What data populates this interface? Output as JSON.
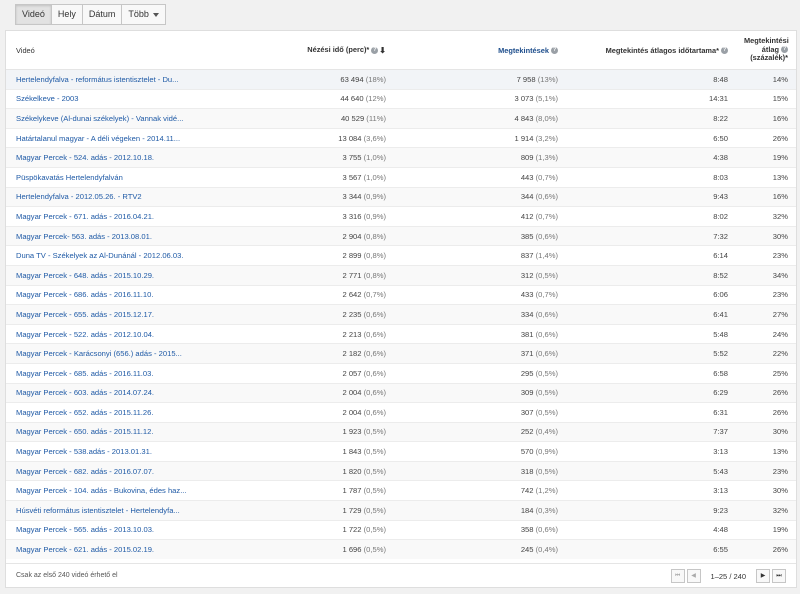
{
  "tabs": [
    {
      "label": "Videó",
      "active": true
    },
    {
      "label": "Hely",
      "active": false
    },
    {
      "label": "Dátum",
      "active": false
    },
    {
      "label": "Több",
      "active": false,
      "dropdown": true
    }
  ],
  "table": {
    "headers": {
      "video": "Videó",
      "watch_time": "Nézési idő (perc)*",
      "views": "Megtekintések",
      "avg_duration": "Megtekintés átlagos időtartama*",
      "avg_pct_line1": "Megtekintési",
      "avg_pct_line2": "átlag",
      "avg_pct_line3": "(százalék)*"
    },
    "help_glyph": "?",
    "sort_glyph": "⬇",
    "rows": [
      {
        "title": "Hertelendyfalva - református istentisztelet - Du...",
        "watch": "63 494",
        "watch_pct": "(18%)",
        "views": "7 958",
        "views_pct": "(13%)",
        "dur": "8:48",
        "avg": "14%"
      },
      {
        "title": "Székelkeve - 2003",
        "watch": "44 640",
        "watch_pct": "(12%)",
        "views": "3 073",
        "views_pct": "(5,1%)",
        "dur": "14:31",
        "avg": "15%"
      },
      {
        "title": "Székelykeve (Al-dunai székelyek) - Vannak vidé...",
        "watch": "40 529",
        "watch_pct": "(11%)",
        "views": "4 843",
        "views_pct": "(8,0%)",
        "dur": "8:22",
        "avg": "16%"
      },
      {
        "title": "Határtalanul magyar - A déli végeken - 2014.11...",
        "watch": "13 084",
        "watch_pct": "(3,6%)",
        "views": "1 914",
        "views_pct": "(3,2%)",
        "dur": "6:50",
        "avg": "26%"
      },
      {
        "title": "Magyar Percek - 524. adás - 2012.10.18.",
        "watch": "3 755",
        "watch_pct": "(1,0%)",
        "views": "809",
        "views_pct": "(1,3%)",
        "dur": "4:38",
        "avg": "19%"
      },
      {
        "title": "Püspökavatás Hertelendyfalván",
        "watch": "3 567",
        "watch_pct": "(1,0%)",
        "views": "443",
        "views_pct": "(0,7%)",
        "dur": "8:03",
        "avg": "13%"
      },
      {
        "title": "Hertelendyfalva - 2012.05.26. - RTV2",
        "watch": "3 344",
        "watch_pct": "(0,9%)",
        "views": "344",
        "views_pct": "(0,6%)",
        "dur": "9:43",
        "avg": "16%"
      },
      {
        "title": "Magyar Percek - 671. adás - 2016.04.21.",
        "watch": "3 316",
        "watch_pct": "(0,9%)",
        "views": "412",
        "views_pct": "(0,7%)",
        "dur": "8:02",
        "avg": "32%"
      },
      {
        "title": "Magyar Percek- 563. adás - 2013.08.01.",
        "watch": "2 904",
        "watch_pct": "(0,8%)",
        "views": "385",
        "views_pct": "(0,6%)",
        "dur": "7:32",
        "avg": "30%"
      },
      {
        "title": "Duna TV - Székelyek az Al-Dunánál - 2012.06.03.",
        "watch": "2 899",
        "watch_pct": "(0,8%)",
        "views": "837",
        "views_pct": "(1,4%)",
        "dur": "6:14",
        "avg": "23%"
      },
      {
        "title": "Magyar Percek - 648. adás - 2015.10.29.",
        "watch": "2 771",
        "watch_pct": "(0,8%)",
        "views": "312",
        "views_pct": "(0,5%)",
        "dur": "8:52",
        "avg": "34%"
      },
      {
        "title": "Magyar Percek - 686. adás - 2016.11.10.",
        "watch": "2 642",
        "watch_pct": "(0,7%)",
        "views": "433",
        "views_pct": "(0,7%)",
        "dur": "6:06",
        "avg": "23%"
      },
      {
        "title": "Magyar Percek - 655. adás - 2015.12.17.",
        "watch": "2 235",
        "watch_pct": "(0,6%)",
        "views": "334",
        "views_pct": "(0,6%)",
        "dur": "6:41",
        "avg": "27%"
      },
      {
        "title": "Magyar Percek - 522. adás - 2012.10.04.",
        "watch": "2 213",
        "watch_pct": "(0,6%)",
        "views": "381",
        "views_pct": "(0,6%)",
        "dur": "5:48",
        "avg": "24%"
      },
      {
        "title": "Magyar Percek - Karácsonyi (656.) adás - 2015...",
        "watch": "2 182",
        "watch_pct": "(0,6%)",
        "views": "371",
        "views_pct": "(0,6%)",
        "dur": "5:52",
        "avg": "22%"
      },
      {
        "title": "Magyar Percek - 685. adás - 2016.11.03.",
        "watch": "2 057",
        "watch_pct": "(0,6%)",
        "views": "295",
        "views_pct": "(0,5%)",
        "dur": "6:58",
        "avg": "25%"
      },
      {
        "title": "Magyar Percek - 603. adás - 2014.07.24.",
        "watch": "2 004",
        "watch_pct": "(0,6%)",
        "views": "309",
        "views_pct": "(0,5%)",
        "dur": "6:29",
        "avg": "26%"
      },
      {
        "title": "Magyar Percek - 652. adás - 2015.11.26.",
        "watch": "2 004",
        "watch_pct": "(0,6%)",
        "views": "307",
        "views_pct": "(0,5%)",
        "dur": "6:31",
        "avg": "26%"
      },
      {
        "title": "Magyar Percek - 650. adás - 2015.11.12.",
        "watch": "1 923",
        "watch_pct": "(0,5%)",
        "views": "252",
        "views_pct": "(0,4%)",
        "dur": "7:37",
        "avg": "30%"
      },
      {
        "title": "Magyar Percek - 538.adás - 2013.01.31.",
        "watch": "1 843",
        "watch_pct": "(0,5%)",
        "views": "570",
        "views_pct": "(0,9%)",
        "dur": "3:13",
        "avg": "13%"
      },
      {
        "title": "Magyar Percek - 682. adás - 2016.07.07.",
        "watch": "1 820",
        "watch_pct": "(0,5%)",
        "views": "318",
        "views_pct": "(0,5%)",
        "dur": "5:43",
        "avg": "23%"
      },
      {
        "title": "Magyar Percek - 104. adás - Bukovina, édes haz...",
        "watch": "1 787",
        "watch_pct": "(0,5%)",
        "views": "742",
        "views_pct": "(1,2%)",
        "dur": "3:13",
        "avg": "30%"
      },
      {
        "title": "Húsvéti református istentisztelet - Hertelendyfa...",
        "watch": "1 729",
        "watch_pct": "(0,5%)",
        "views": "184",
        "views_pct": "(0,3%)",
        "dur": "9:23",
        "avg": "32%"
      },
      {
        "title": "Magyar Percek - 565. adás - 2013.10.03.",
        "watch": "1 722",
        "watch_pct": "(0,5%)",
        "views": "358",
        "views_pct": "(0,6%)",
        "dur": "4:48",
        "avg": "19%"
      },
      {
        "title": "Magyar Percek - 621. adás - 2015.02.19.",
        "watch": "1 696",
        "watch_pct": "(0,5%)",
        "views": "245",
        "views_pct": "(0,4%)",
        "dur": "6:55",
        "avg": "26%"
      }
    ]
  },
  "footer": {
    "note": "Csak az első 240 videó érhető el",
    "range": "1–25 / 240",
    "first": "⏮",
    "prev": "◀",
    "next": "▶",
    "last": "⏭"
  }
}
